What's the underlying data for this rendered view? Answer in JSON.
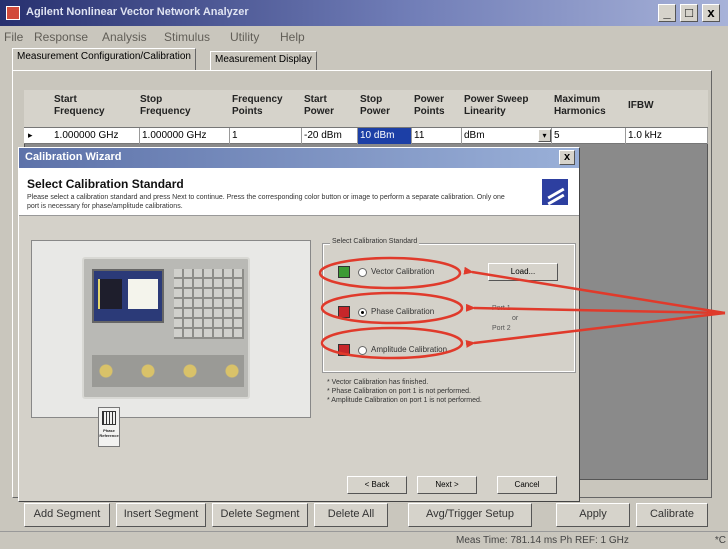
{
  "window": {
    "title": "Agilent Nonlinear Vector Network Analyzer",
    "minimize_label": "_",
    "maximize_label": "□",
    "close_label": "x"
  },
  "menu": [
    "File",
    "Response",
    "Analysis",
    "Stimulus",
    "Utility",
    "Help"
  ],
  "tabs": [
    {
      "label": "Measurement Configuration/Calibration",
      "active": true
    },
    {
      "label": "Measurement Display",
      "active": false
    }
  ],
  "grid": {
    "columns": [
      "Start Frequency",
      "Stop Frequency",
      "Frequency Points",
      "Start Power",
      "Stop Power",
      "Power Points",
      "Power Sweep Linearity",
      "Maximum Harmonics",
      "IFBW"
    ],
    "row_marker": "▸",
    "row": [
      "1.000000 GHz",
      "1.000000 GHz",
      "1",
      "-20 dBm",
      "10 dBm",
      "11",
      "dBm",
      "5",
      "1.0 kHz"
    ],
    "dropdown_arrow": "▾"
  },
  "dialog": {
    "title": "Calibration Wizard",
    "close_label": "x",
    "heading": "Select Calibration Standard",
    "description": "Please select a calibration standard and press Next to continue. Press the corresponding color button or image to perform a separate calibration. Only one port is necessary for phase/amplitude calibrations.",
    "group_label": "Select Calibration Standard",
    "options": [
      {
        "label": "Vector Calibration",
        "status_color": "#3c9a34",
        "selected": false
      },
      {
        "label": "Phase Calibration",
        "status_color": "#c7262a",
        "selected": true
      },
      {
        "label": "Amplitude Calibration",
        "status_color": "#c7262a",
        "selected": false
      }
    ],
    "load_label": "Load...",
    "ports": {
      "port1": "Port 1",
      "or": "or",
      "port2": "Port 2"
    },
    "notes": [
      "* Vector Calibration has finished.",
      "* Phase Calibration on port 1 is not performed.",
      "* Amplitude Calibration on port 1 is not performed."
    ],
    "phase_ref_label": "Phase Reference",
    "back_label": "< Back",
    "next_label": "Next >",
    "cancel_label": "Cancel"
  },
  "bottom_buttons": [
    "Add Segment",
    "Insert Segment",
    "Delete Segment",
    "Delete All",
    "Avg/Trigger Setup",
    "Apply",
    "Calibrate"
  ],
  "status": {
    "text": "Meas Time: 781.14 ms   Ph REF: 1 GHz",
    "right": "*C"
  },
  "annotation": {
    "color": "#e03a2b"
  }
}
